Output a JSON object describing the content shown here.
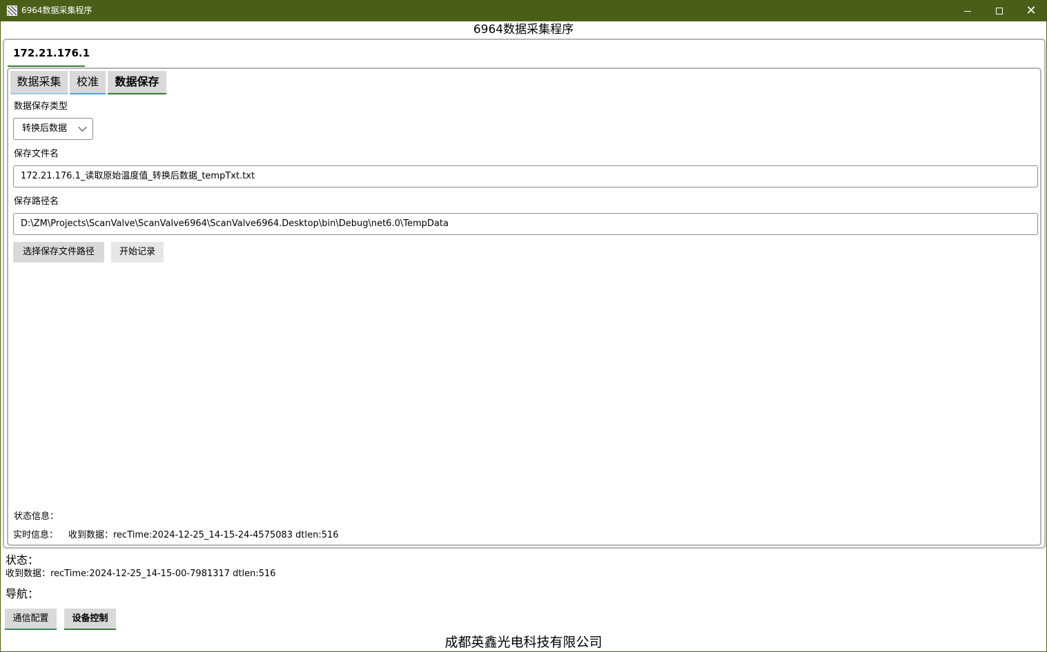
{
  "window": {
    "title": "6964数据采集程序",
    "icons": {
      "app": "app-icon",
      "minimize": "minimize-icon",
      "maximize": "maximize-icon",
      "close": "close-icon"
    },
    "accent": "#4b5e17"
  },
  "header": {
    "title": "6964数据采集程序"
  },
  "device_tab": {
    "label": "172.21.176.1"
  },
  "subtabs": [
    {
      "label": "数据采集"
    },
    {
      "label": "校准"
    },
    {
      "label": "数据保存"
    }
  ],
  "save_panel": {
    "type_label": "数据保存类型",
    "type_selected": "转换后数据",
    "filename_label": "保存文件名",
    "filename_value": "172.21.176.1_读取原始温度值_转换后数据_tempTxt.txt",
    "path_label": "保存路径名",
    "path_value": "D:\\ZM\\Projects\\ScanValve\\ScanValve6964\\ScanValve6964.Desktop\\bin\\Debug\\net6.0\\TempData",
    "choose_path_button": "选择保存文件路径",
    "start_record_button": "开始记录",
    "state_info_label": "状态信息：",
    "realtime_label": "实时信息：",
    "realtime_value": "收到数据：recTime:2024-12-25_14-15-24-4575083 dtlen:516"
  },
  "status": {
    "label": "状态：",
    "value": "收到数据：recTime:2024-12-25_14-15-00-7981317 dtlen:516"
  },
  "nav": {
    "label": "导航：",
    "buttons": [
      {
        "label": "通信配置"
      },
      {
        "label": "设备控制"
      }
    ]
  },
  "footer": {
    "company": "成都英鑫光电科技有限公司"
  }
}
